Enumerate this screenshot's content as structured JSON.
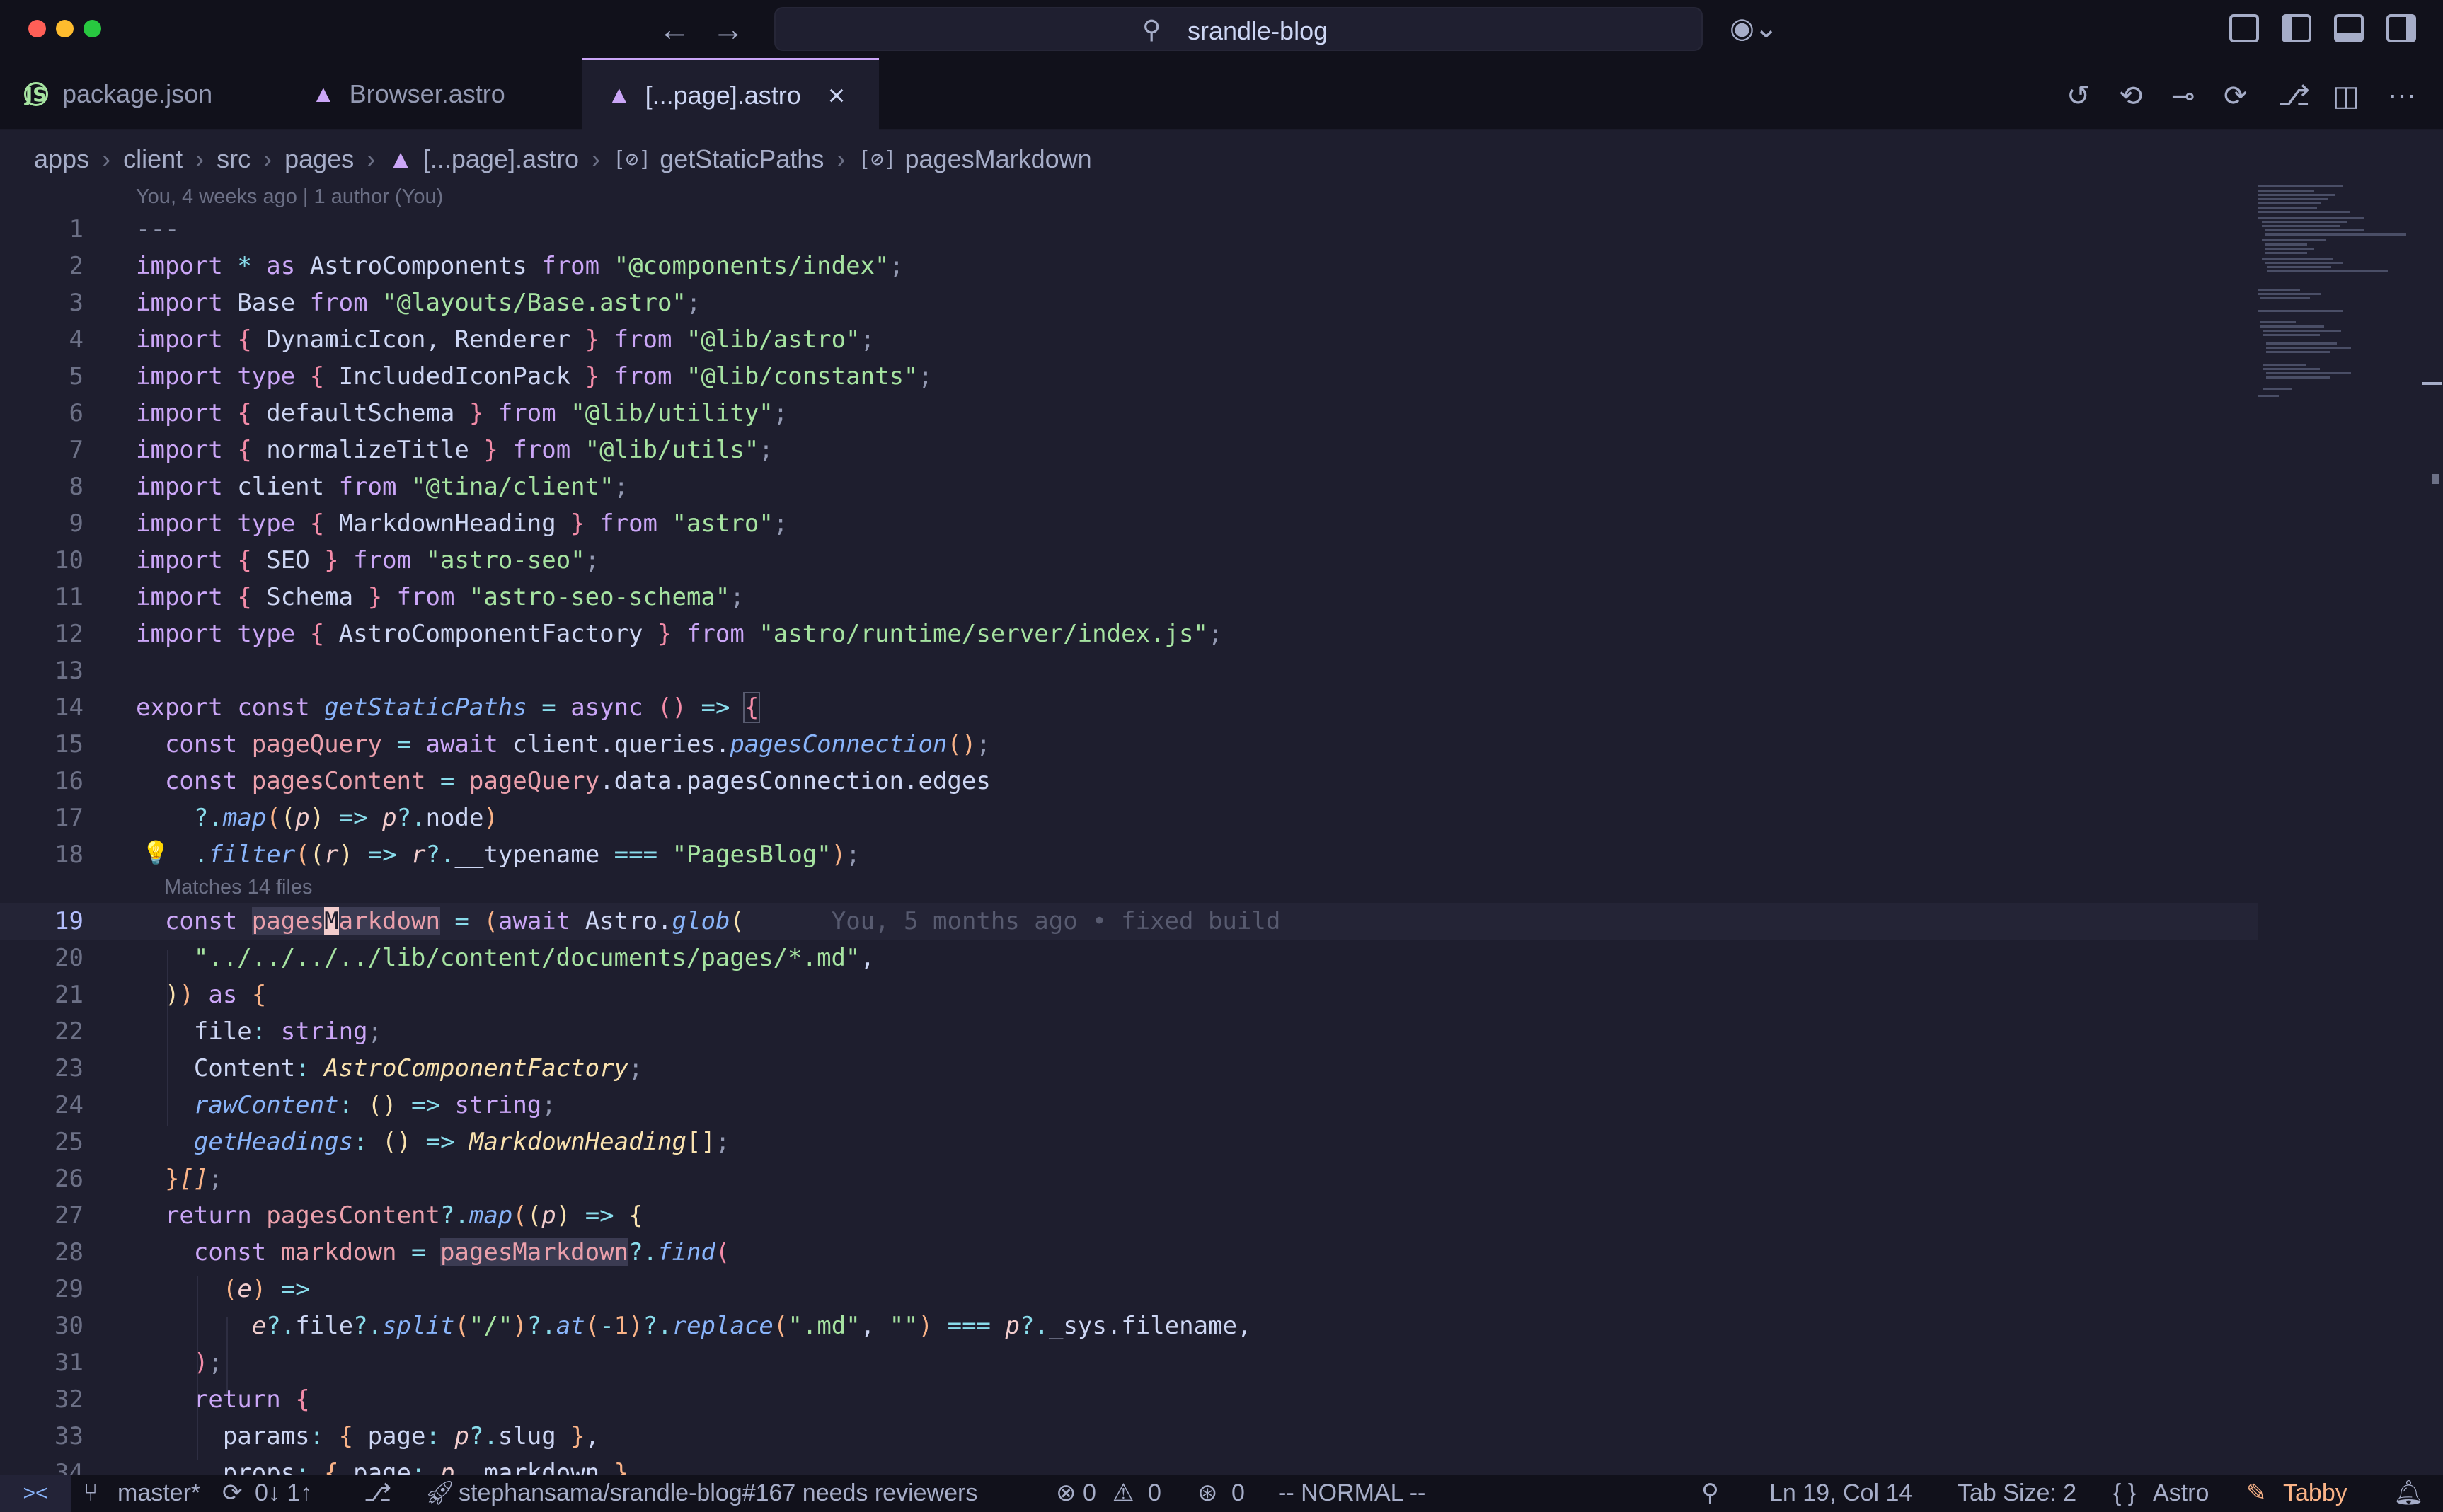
{
  "titlebar": {
    "search_text": "srandle-blog"
  },
  "tabs": [
    {
      "label": "package.json",
      "icon": "js-icon"
    },
    {
      "label": "Browser.astro",
      "icon": "astro-icon"
    },
    {
      "label": "[...page].astro",
      "icon": "astro-icon",
      "active": true
    }
  ],
  "breadcrumb": [
    "apps",
    "client",
    "src",
    "pages",
    "[...page].astro",
    "getStaticPaths",
    "pagesMarkdown"
  ],
  "editor": {
    "blame_header": "You, 4 weeks ago | 1 author (You)",
    "hint_matches": "Matches 14 files",
    "inline_blame": "You, 5 months ago • fixed build",
    "line_numbers": [
      "1",
      "2",
      "3",
      "4",
      "5",
      "6",
      "7",
      "8",
      "9",
      "10",
      "11",
      "12",
      "13",
      "14",
      "15",
      "16",
      "17",
      "18",
      "19",
      "20",
      "21",
      "22",
      "23",
      "24",
      "25",
      "26",
      "27",
      "28",
      "29",
      "30",
      "31",
      "32",
      "33",
      "34"
    ]
  },
  "statusbar": {
    "branch": "master*",
    "sync": "0↓ 1↑",
    "pr": "stephansama/srandle-blog#167 needs reviewers",
    "errors": "0",
    "warnings": "0",
    "ports": "0",
    "mode": "-- NORMAL --",
    "position": "Ln 19, Col 14",
    "tab_size": "Tab Size: 2",
    "language": "Astro",
    "assistant": "Tabby"
  },
  "colors": {
    "background": "#1e1e2e",
    "accent": "#cba6f7",
    "string": "#a6e3a1",
    "function": "#89b4fa",
    "type": "#f9e2af"
  }
}
